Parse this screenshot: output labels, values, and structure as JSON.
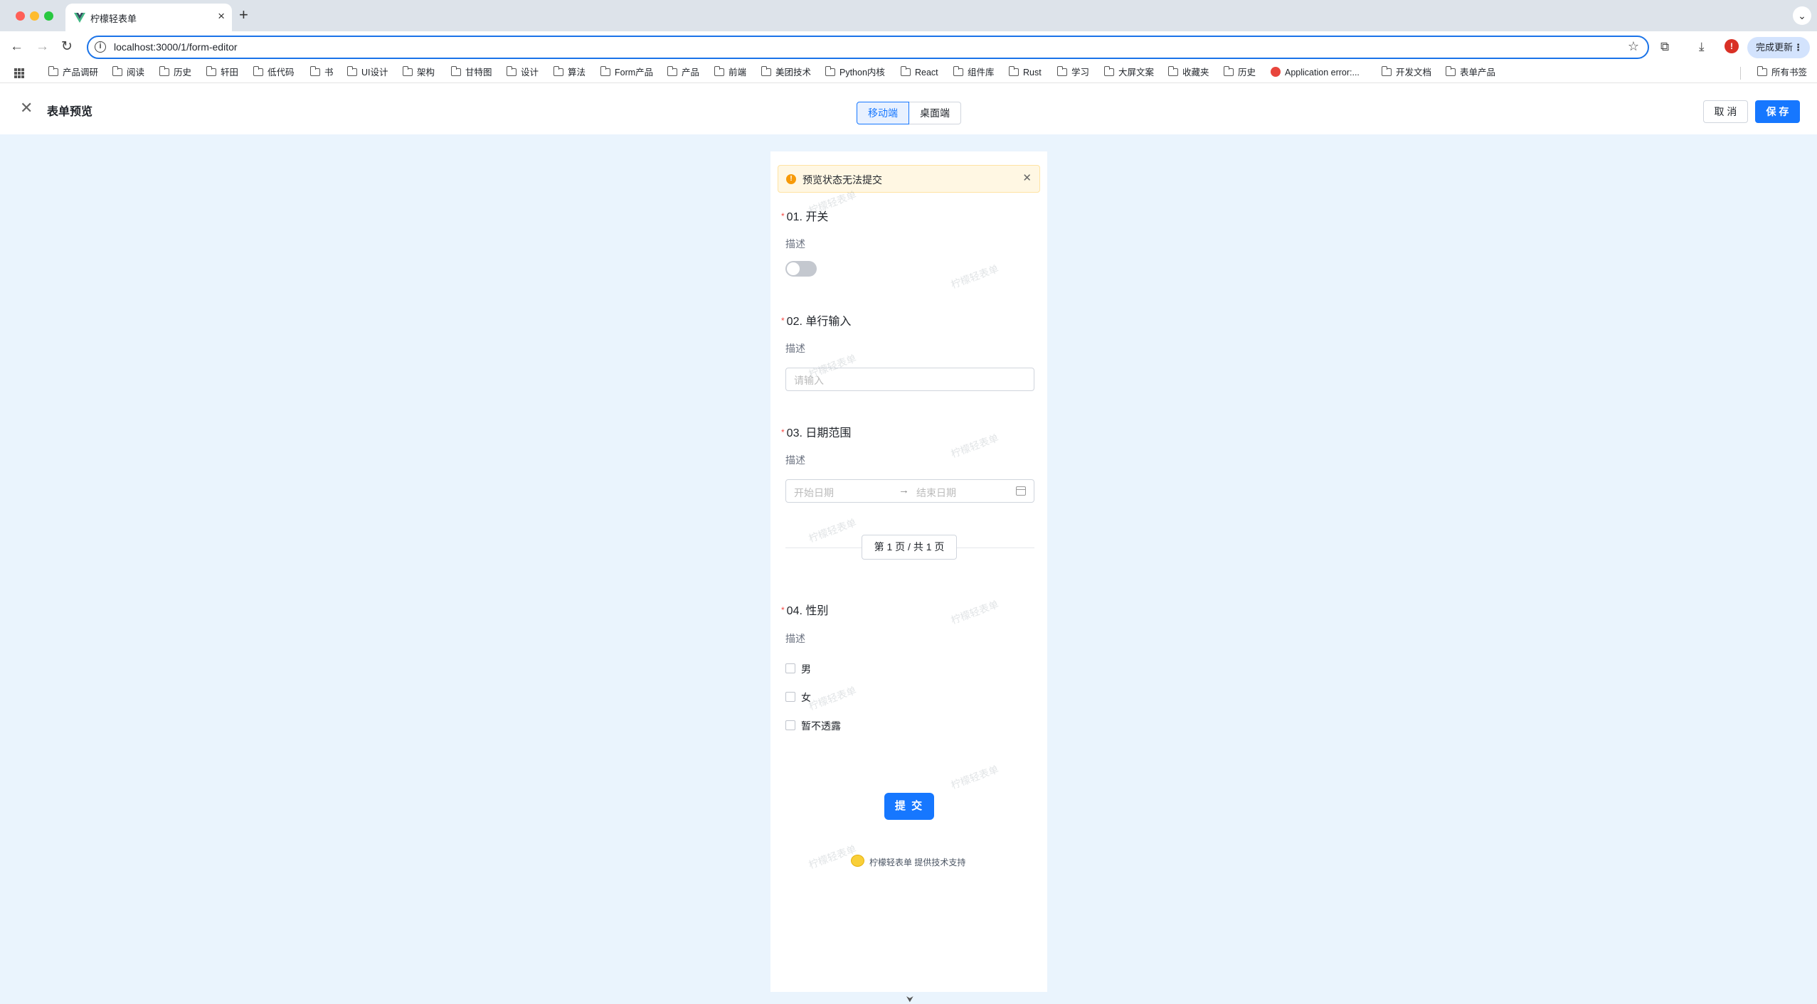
{
  "browser": {
    "tab_title": "柠檬轻表单",
    "url": "localhost:3000/1/form-editor",
    "update_label": "完成更新",
    "alert_badge": "!",
    "bookmarks": [
      "产品调研",
      "阅读",
      "历史",
      "轩田",
      "低代码",
      "书",
      "UI设计",
      "架构",
      "甘特图",
      "设计",
      "算法",
      "Form产品",
      "产品",
      "前端",
      "美团技术",
      "Python内核",
      "React",
      "组件库",
      "Rust",
      "学习",
      "大屏文案",
      "收藏夹",
      "历史",
      "Application error:...",
      "开发文档",
      "表单产品"
    ],
    "all_bookmarks": "所有书签"
  },
  "header": {
    "title": "表单预览",
    "modes": [
      "移动端",
      "桌面端"
    ],
    "active_mode": "移动端",
    "cancel_label": "取 消",
    "save_label": "保 存"
  },
  "form": {
    "alert": "预览状态无法提交",
    "watermark": "柠檬轻表单",
    "questions": [
      {
        "title": "01. 开关",
        "desc": "描述",
        "type": "switch",
        "value": false
      },
      {
        "title": "02. 单行输入",
        "desc": "描述",
        "type": "input",
        "placeholder": "请输入"
      },
      {
        "title": "03. 日期范围",
        "desc": "描述",
        "type": "daterange",
        "start_placeholder": "开始日期",
        "end_placeholder": "结束日期"
      },
      {
        "title": "04. 性别",
        "desc": "描述",
        "type": "checkbox",
        "options": [
          "男",
          "女",
          "暂不透露"
        ]
      }
    ],
    "pager": "第 1 页 / 共 1 页",
    "submit_label": "提 交",
    "footer": "柠檬轻表单 提供技术支持"
  },
  "colors": {
    "primary": "#1677ff",
    "alert_bg": "#fff7e3",
    "alert_icon": "#f79a08",
    "required": "#f54a45",
    "canvas_bg": "#eaf4fd"
  }
}
